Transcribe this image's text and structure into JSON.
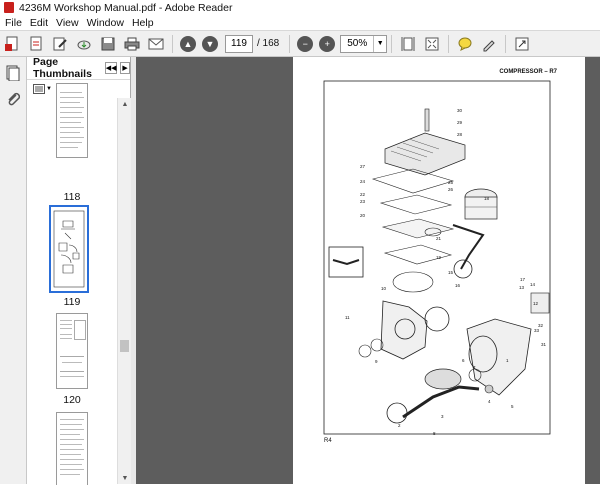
{
  "window": {
    "title": "4236M Workshop Manual.pdf - Adobe Reader"
  },
  "menu": [
    "File",
    "Edit",
    "View",
    "Window",
    "Help"
  ],
  "toolbar": {
    "page_current": "119",
    "page_total": "/ 168",
    "zoom": "50%",
    "icons": [
      "create-pdf-icon",
      "open-icon",
      "edit-icon",
      "cloud-icon",
      "save-icon",
      "print-icon",
      "email-icon",
      "prev-page-icon",
      "next-page-icon",
      "zoom-out-icon",
      "zoom-in-icon",
      "fit-page-icon",
      "full-screen-icon",
      "comment-icon",
      "sign-icon",
      "expand-icon"
    ]
  },
  "thumbnails_panel": {
    "title": "Page Thumbnails",
    "pages": [
      {
        "label": "118",
        "selected": false
      },
      {
        "label": "119",
        "selected": true
      },
      {
        "label": "120",
        "selected": false
      },
      {
        "label": "",
        "selected": false
      }
    ]
  },
  "document": {
    "header": "COMPRESSOR – R7",
    "footer": "R4",
    "callouts": [
      "30",
      "29",
      "28",
      "27",
      "24",
      "25",
      "26",
      "22",
      "23",
      "20",
      "21",
      "19",
      "18",
      "17",
      "16",
      "15",
      "14",
      "13",
      "12",
      "11",
      "10",
      "9",
      "8",
      "7",
      "6",
      "5",
      "4",
      "3",
      "2",
      "1",
      "33",
      "32",
      "31"
    ]
  },
  "colors": {
    "accent": "#2a6ed8",
    "doc_bg": "#5d5d5d",
    "toolbar_bg": "#f0f0f0"
  }
}
